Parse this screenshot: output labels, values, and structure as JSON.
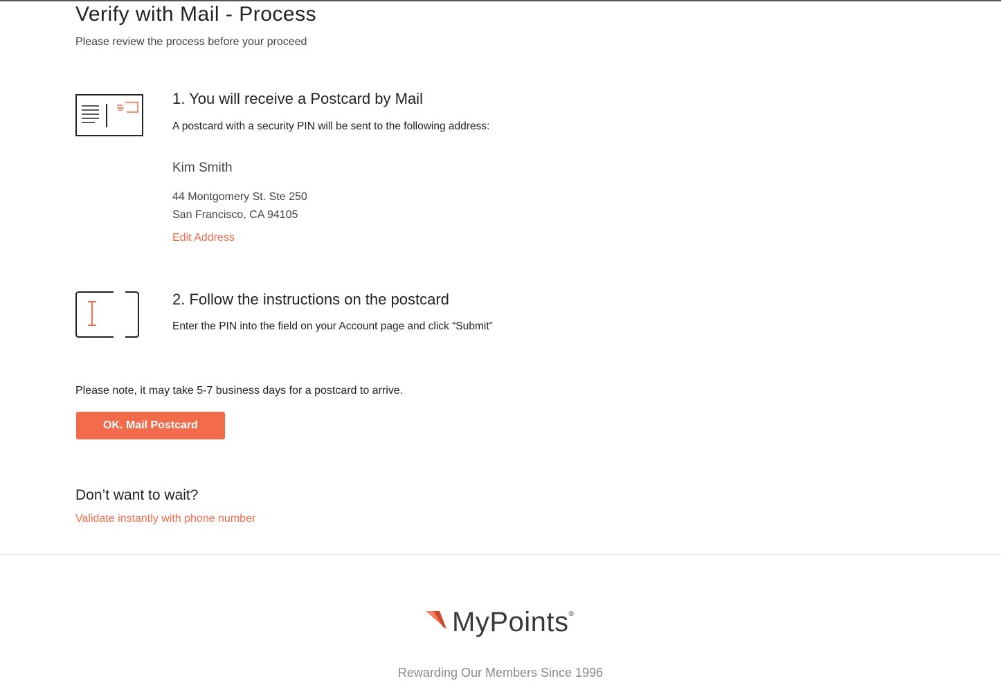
{
  "header": {
    "title": "Verify with Mail - Process",
    "subtitle": "Please review the process before your proceed"
  },
  "step1": {
    "icon": "postcard-icon",
    "heading": "1. You will receive a Postcard by Mail",
    "description": "A postcard with a security PIN will be sent to the following address:",
    "address": {
      "name": "Kim Smith",
      "line1": "44 Montgomery St. Ste 250",
      "line2": "San Francisco, CA 94105"
    },
    "edit_label": "Edit Address"
  },
  "step2": {
    "icon": "text-input-icon",
    "heading": "2. Follow the instructions on the postcard",
    "description": "Enter the PIN into the field on your Account page and click “Submit”"
  },
  "note": "Please note, it may take 5-7 business days for a postcard to arrive.",
  "primary_button": "OK. Mail Postcard",
  "alternative": {
    "heading": "Don’t want to wait?",
    "link": "Validate instantly with phone number"
  },
  "footer": {
    "logo_text": "MyPoints",
    "logo_mark": "®",
    "tagline": "Rewarding Our Members Since 1996"
  },
  "colors": {
    "accent": "#f26b4a",
    "text": "#222222",
    "muted": "#888888"
  }
}
